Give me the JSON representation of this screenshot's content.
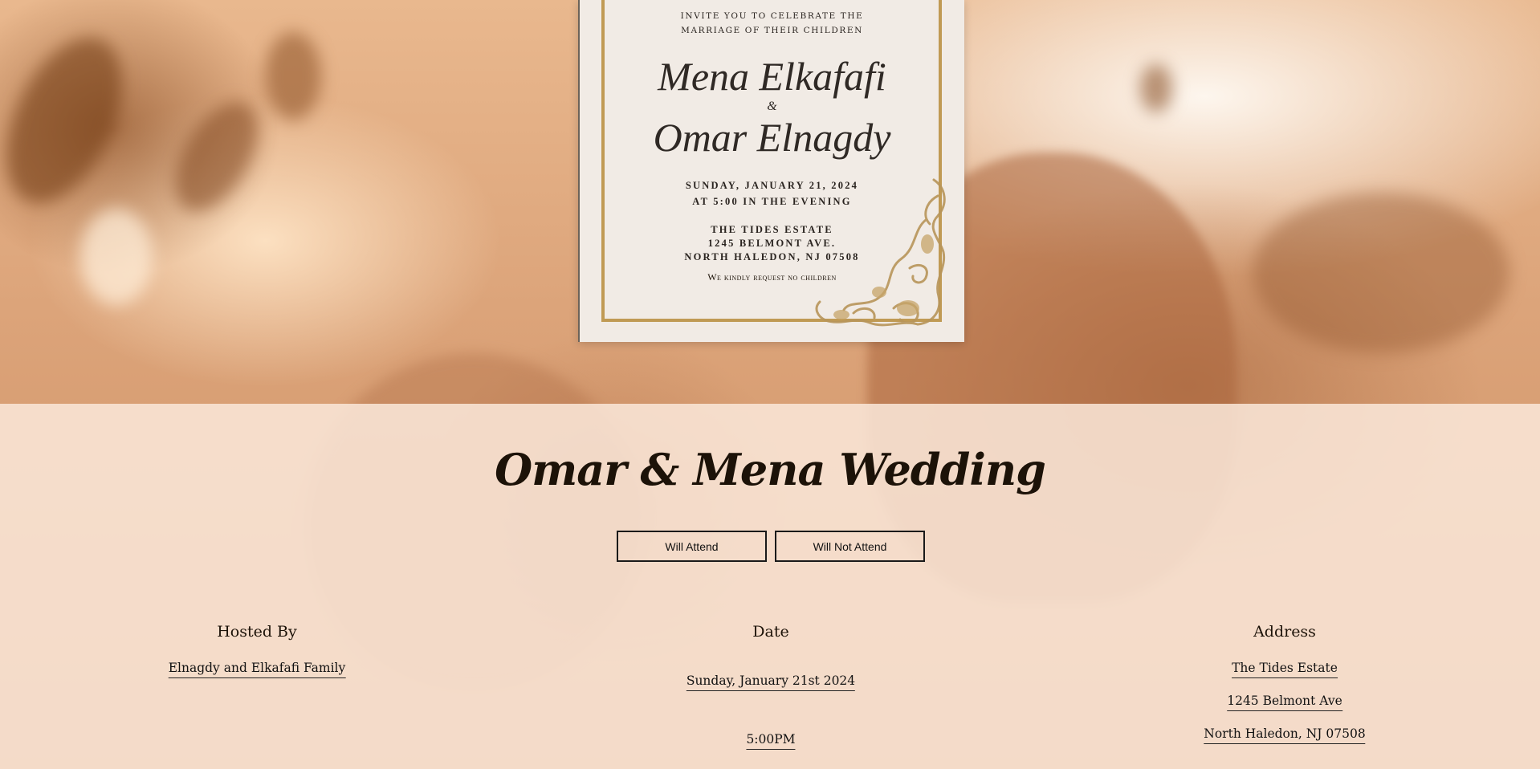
{
  "invitation": {
    "line1": "INVITE YOU TO CELEBRATE THE",
    "line2": "MARRIAGE OF THEIR CHILDREN",
    "name1": "Mena Elkafafi",
    "ampersand": "&",
    "name2": "Omar Elnagdy",
    "date_line": "SUNDAY, JANUARY 21, 2024",
    "time_line": "AT 5:00 IN THE EVENING",
    "venue": "THE TIDES ESTATE",
    "street": "1245 BELMONT AVE.",
    "city": "NORTH HALEDON, NJ 07508",
    "note": "We kindly request no children"
  },
  "title": "Omar & Mena Wedding",
  "rsvp": {
    "attend_label": "Will Attend",
    "not_attend_label": "Will Not Attend"
  },
  "hosted_by": {
    "heading": "Hosted By",
    "value": "Elnagdy and Elkafafi Family"
  },
  "date": {
    "heading": "Date",
    "day": "Sunday, January 21st 2024",
    "time": "5:00PM"
  },
  "address": {
    "heading": "Address",
    "venue": "The Tides Estate",
    "street": "1245 Belmont Ave",
    "city": "North Haledon, NJ 07508"
  },
  "colors": {
    "accent_gold": "#c09a54",
    "text_dark": "#1c1208",
    "overlay": "#fae8da"
  }
}
